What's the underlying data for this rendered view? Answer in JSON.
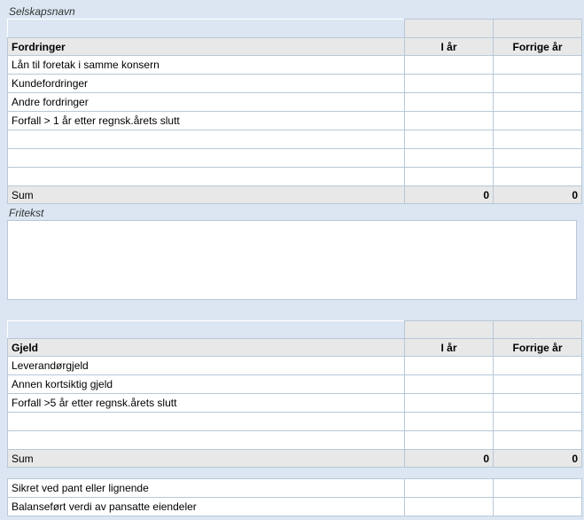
{
  "labels": {
    "selskapsnavn": "Selskapsnavn",
    "fritekst": "Fritekst"
  },
  "cols": {
    "this_year": "I år",
    "prev_year": "Forrige år"
  },
  "fordringer": {
    "header": "Fordringer",
    "rows": [
      {
        "label": "Lån til foretak i samme konsern",
        "this": "",
        "prev": ""
      },
      {
        "label": "Kundefordringer",
        "this": "",
        "prev": ""
      },
      {
        "label": "Andre fordringer",
        "this": "",
        "prev": ""
      },
      {
        "label": "Forfall > 1 år etter regnsk.årets slutt",
        "this": "",
        "prev": ""
      },
      {
        "label": "",
        "this": "",
        "prev": ""
      },
      {
        "label": "",
        "this": "",
        "prev": ""
      },
      {
        "label": "",
        "this": "",
        "prev": ""
      }
    ],
    "sum": {
      "label": "Sum",
      "this": "0",
      "prev": "0"
    }
  },
  "gjeld": {
    "header": "Gjeld",
    "rows": [
      {
        "label": "Leverandørgjeld",
        "this": "",
        "prev": ""
      },
      {
        "label": "Annen kortsiktig gjeld",
        "this": "",
        "prev": ""
      },
      {
        "label": "Forfall >5 år etter regnsk.årets slutt",
        "this": "",
        "prev": ""
      },
      {
        "label": "",
        "this": "",
        "prev": ""
      },
      {
        "label": "",
        "this": "",
        "prev": ""
      }
    ],
    "sum": {
      "label": "Sum",
      "this": "0",
      "prev": "0"
    }
  },
  "pant": {
    "rows": [
      {
        "label": "Sikret ved pant eller lignende",
        "this": "",
        "prev": ""
      },
      {
        "label": "Balanseført verdi av pansatte eiendeler",
        "this": "",
        "prev": ""
      }
    ]
  },
  "fritekst_value": ""
}
